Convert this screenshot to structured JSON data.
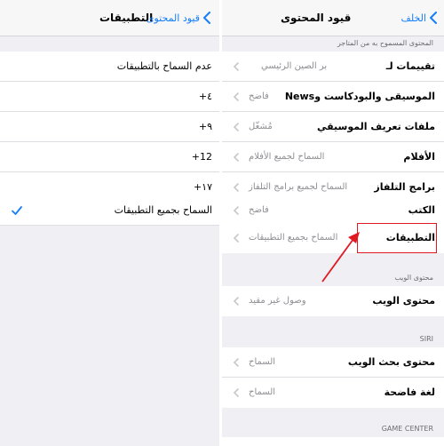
{
  "left": {
    "nav": {
      "title": "التطبيقات",
      "back_label": "قيود المحتوى"
    },
    "options": [
      "عدم السماح بالتطبيقات",
      "٤+",
      "٩+",
      "12+",
      "١٧+",
      "السماح بجميع التطبيقات"
    ],
    "selected_index": 5
  },
  "right": {
    "nav": {
      "title": "قيود المحتوى",
      "back_label": "الخلف"
    },
    "section_allowed_header": "المحتوى المسموح به من المتاجر",
    "rows": [
      {
        "label": "تقييمات لـ",
        "value": "بر الصين الرئيسي"
      },
      {
        "label": "الموسيقى والبودكاست وNews",
        "value": "فاضح"
      },
      {
        "label": "ملفات تعريف الموسيقي",
        "value": "مُشغّل"
      },
      {
        "label": "الأفلام",
        "value": "السماح لجميع الأفلام"
      },
      {
        "label": "برامج التلفاز",
        "value": "السماح لجميع برامج التلفاز"
      },
      {
        "label": "الكتب",
        "value": "فاضح"
      },
      {
        "label": "التطبيقات",
        "value": "السماح بجميع التطبيقات"
      }
    ],
    "web_section_header": "محتوى الويب",
    "web_row": {
      "label": "محتوى الويب",
      "value": "وصول غير مقيد"
    },
    "siri_header": "SIRI",
    "siri_rows": [
      {
        "label": "محتوى بحث الويب",
        "value": "السماح"
      },
      {
        "label": "لغة فاضحة",
        "value": "السماح"
      }
    ],
    "game_center_header": "GAME CENTER"
  },
  "colors": {
    "accent": "#157efb",
    "highlight": "#e11a22",
    "background": "#efeff4"
  }
}
